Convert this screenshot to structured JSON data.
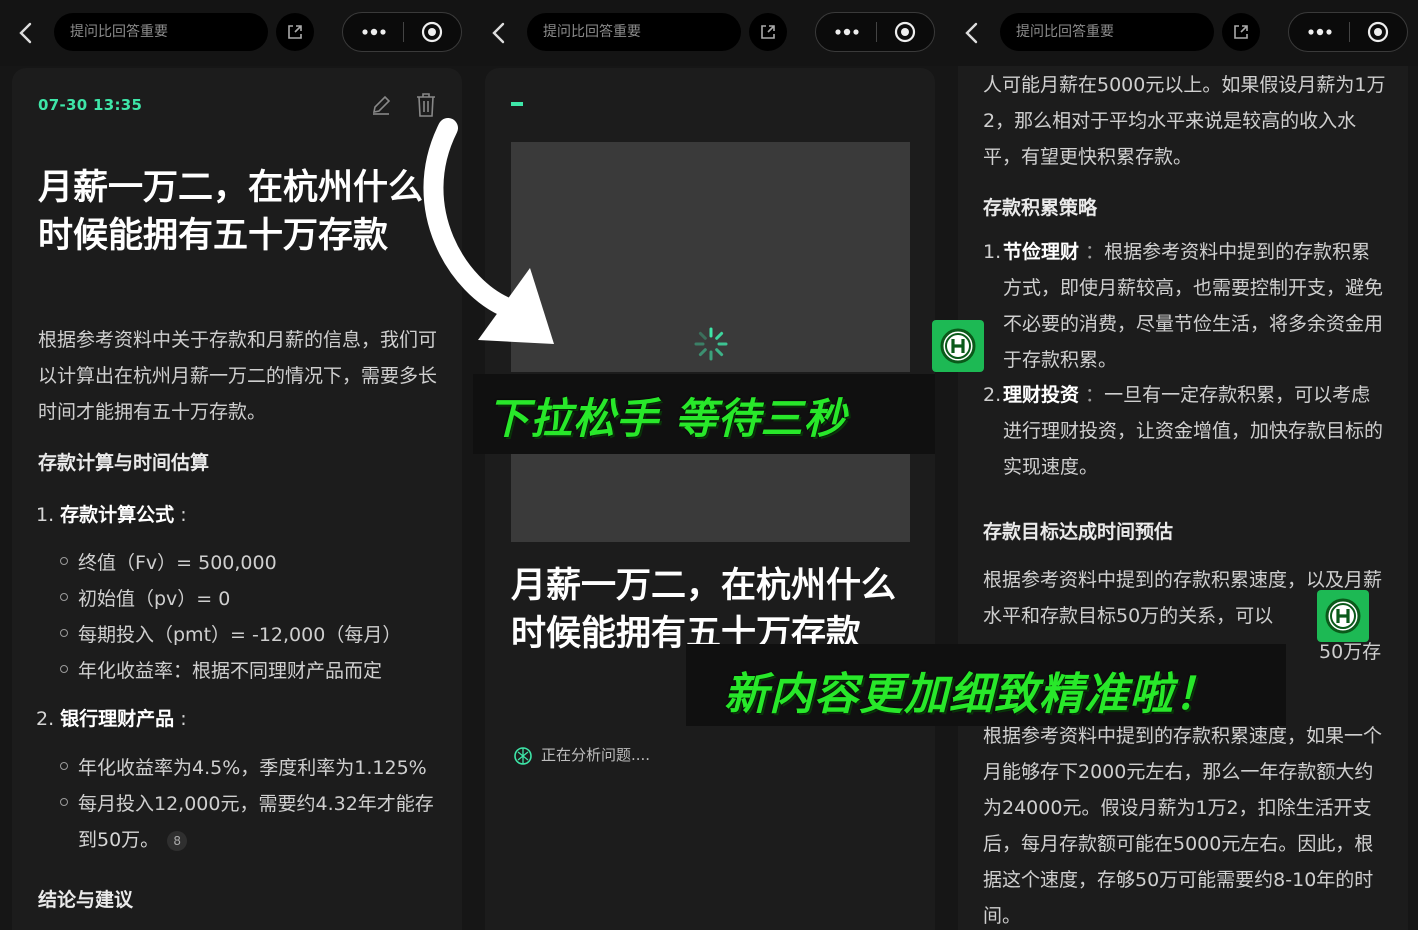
{
  "search_placeholder": "提问比回答重要",
  "panel1": {
    "timestamp": "07-30 13:35",
    "title": "月薪一万二，在杭州什么时候能拥有五十万存款",
    "intro": "根据参考资料中关于存款和月薪的信息，我们可以计算出在杭州月薪一万二的情况下，需要多长时间才能拥有五十万存款。",
    "section1_heading": "存款计算与时间估算",
    "item1_label": "存款计算公式",
    "item1_bullets": [
      "终值（Fv）= 500,000",
      "初始值（pv）= 0",
      "每期投入（pmt）= -12,000（每月）",
      "年化收益率：根据不同理财产品而定"
    ],
    "item2_label": "银行理财产品",
    "item2_bullet1": "年化收益率为4.5%，季度利率为1.125%",
    "item2_bullet2_line1": "每月投入12,000元，需要约4.32年才能存",
    "item2_bullet2_line2": "到50万。",
    "citation": "8",
    "section2_heading": "结论与建议"
  },
  "panel2": {
    "title": "月薪一万二，在杭州什么时候能拥有五十万存款",
    "status": "正在分析问题...."
  },
  "panel3": {
    "para1": "人可能月薪在5000元以上。如果假设月薪为1万2，那么相对于平均水平来说是较高的收入水平，有望更快积累存款。",
    "heading1": "存款积累策略",
    "item1_label": "节俭理财",
    "item1_text": "根据参考资料中提到的存款积累方式，即使月薪较高，也需要控制开支，避免不必要的消费，尽量节俭生活，将多余资金用于存款积累。",
    "item2_label": "理财投资",
    "item2_text": "一旦有一定存款积累，可以考虑进行理财投资，让资金增值，加快存款目标的实现速度。",
    "heading2": "存款目标达成时间预估",
    "para2": "根据参考资料中提到的存款积累速度，以及月薪水平和存款目标50万的关系，可以",
    "para2_tail": "50万存",
    "para3": "根据参考资料中提到的存款积累速度，如果一个月能够存下2000元左右，那么一年存款额大约为24000元。假设月薪为1万2，扣除生活开支后，每月存款额可能在5000元左右。因此，根据这个速度，存够50万可能需要约8-10年的时间。"
  },
  "overlay": {
    "pull_release": "下拉松手 等待三秒",
    "new_content": "新内容更加细致精准啦！"
  },
  "colors": {
    "accent_green": "#3ee6a8",
    "overlay_green": "#28e82a",
    "badge_green": "#1db954"
  }
}
